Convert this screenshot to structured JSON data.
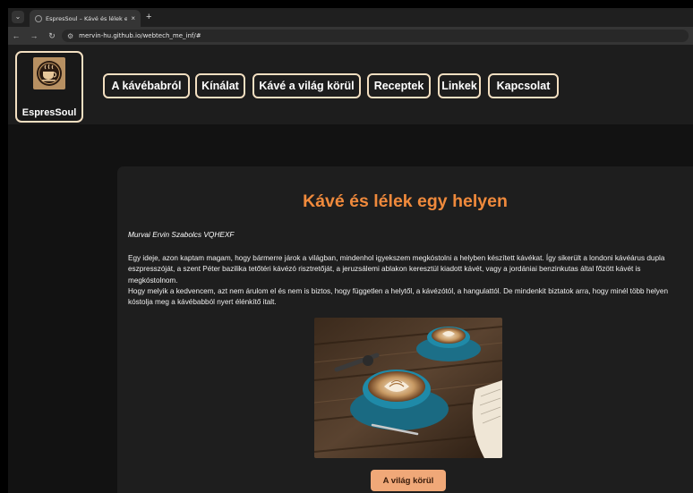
{
  "browser": {
    "tab_title": "EspresSoul – Kávé és lélek egy h",
    "tab_close": "×",
    "new_tab": "+",
    "url": "mervin-hu.github.io/webtech_me_inf/#",
    "icons": [
      "tab-search-icon",
      "favicon-icon",
      "close-icon",
      "plus-icon",
      "back-arrow-icon",
      "forward-arrow-icon",
      "reload-icon",
      "site-settings-icon"
    ]
  },
  "site": {
    "logo_name": "EspresSoul",
    "nav": [
      {
        "label": "A kávébabról"
      },
      {
        "label": "Kínálat"
      },
      {
        "label": "Kávé a világ körül"
      },
      {
        "label": "Receptek"
      },
      {
        "label": "Linkek"
      },
      {
        "label": "Kapcsolat"
      }
    ]
  },
  "main": {
    "title": "Kávé és lélek egy helyen",
    "author": "Murvai Ervin Szabolcs VQHEXF",
    "paragraph1": "Egy ideje, azon kaptam magam, hogy bármerre járok a világban, mindenhol igyekszem megkóstolni a helyben készített kávékat. Így sikerült a londoni kávéárus dupla eszpresszóját, a szent Péter bazilika tetőtéri kávézó risztretőját, a jeruzsálemi ablakon keresztül kiadott kávét, vagy a jordániai benzinkutas által főzött kávét is megkóstolnom.",
    "paragraph2": "Hogy melyik a kedvencem, azt nem árulom el és nem is biztos, hogy független a helytől, a kávézótól, a hangulattól. De mindenkit biztatok arra, hogy minél több helyen kóstolja meg a kávébabból nyert élénkítő italt.",
    "button_label": "A világ körül"
  },
  "colors": {
    "accent_orange": "#f08a3c",
    "button_bg": "#f0a878",
    "nav_border": "#f3dfc1",
    "cup_teal": "#1f8aa8"
  }
}
